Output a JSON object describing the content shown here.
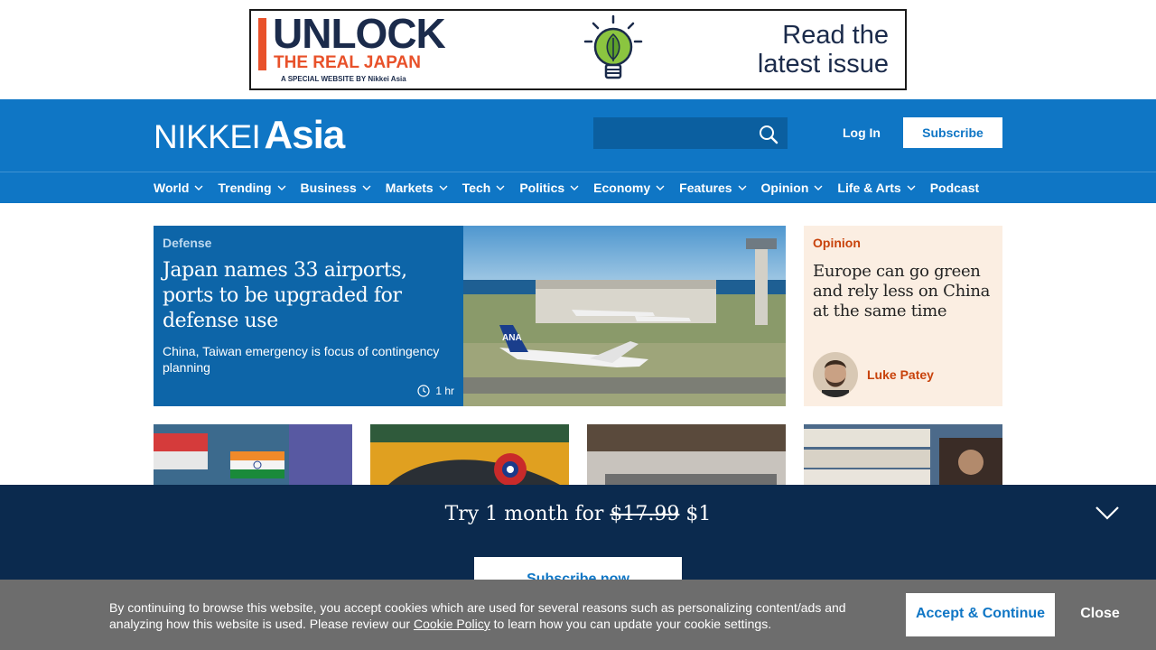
{
  "ad": {
    "line1": "UNLOCK",
    "line2": "THE REAL JAPAN",
    "line3": "A SPECIAL WEBSITE BY Nikkei Asia",
    "cta_line1": "Read the",
    "cta_line2": "latest issue"
  },
  "header": {
    "logo_part1": "NIKKEI",
    "logo_part2": "Asia",
    "search_placeholder": "",
    "login_label": "Log In",
    "subscribe_label": "Subscribe"
  },
  "nav": {
    "items": [
      {
        "label": "World",
        "dropdown": true
      },
      {
        "label": "Trending",
        "dropdown": true
      },
      {
        "label": "Business",
        "dropdown": true
      },
      {
        "label": "Markets",
        "dropdown": true
      },
      {
        "label": "Tech",
        "dropdown": true
      },
      {
        "label": "Politics",
        "dropdown": true
      },
      {
        "label": "Economy",
        "dropdown": true
      },
      {
        "label": "Features",
        "dropdown": true
      },
      {
        "label": "Opinion",
        "dropdown": true
      },
      {
        "label": "Life & Arts",
        "dropdown": true
      },
      {
        "label": "Podcast",
        "dropdown": false
      }
    ]
  },
  "hero": {
    "section": "Defense",
    "title": "Japan names 33 airports, ports to be upgraded for defense use",
    "subtitle": "China, Taiwan emergency is focus of contingency planning",
    "time": "1 hr"
  },
  "opinion": {
    "section": "Opinion",
    "title": "Europe can go green and rely less on China at the same time",
    "author": "Luke Patey"
  },
  "promo": {
    "text_prefix": "Try 1 month for",
    "old_price": "$17.99",
    "new_price": "$1",
    "button_label": "Subscribe now"
  },
  "cookie": {
    "text_before": "By continuing to browse this website, you accept cookies which are used for several reasons such as personalizing content/ads and analyzing how this website is used. Please review our",
    "link_label": "Cookie Policy",
    "text_after": "to learn how you can update your cookie settings.",
    "accept_label": "Accept & Continue",
    "close_label": "Close"
  },
  "colors": {
    "brand_blue": "#0f76c5",
    "promo_navy": "#0b2a4e",
    "accent_orange": "#c8420b"
  }
}
